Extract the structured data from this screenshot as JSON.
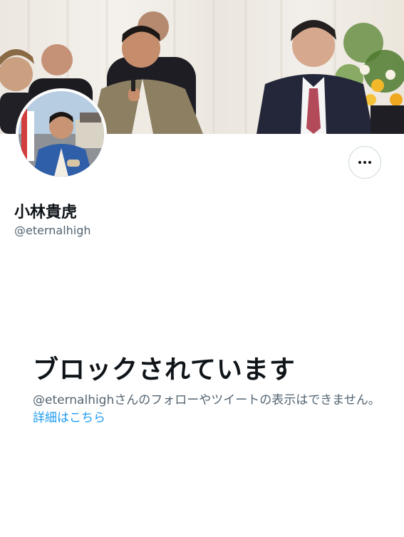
{
  "banner": {
    "description_icon": "profile-banner-photo"
  },
  "profile": {
    "display_name": "小林貴虎",
    "handle": "@eternalhigh"
  },
  "blocked": {
    "title": "ブロックされています",
    "description": "@eternalhighさんのフォローやツイートの表示はできません。",
    "link_label": "詳細はこちら"
  },
  "actions": {
    "more_icon": "more-options-icon"
  },
  "colors": {
    "text_primary": "#0f1419",
    "text_secondary": "#536471",
    "link": "#1d9bf0",
    "border": "#cfd9de"
  }
}
